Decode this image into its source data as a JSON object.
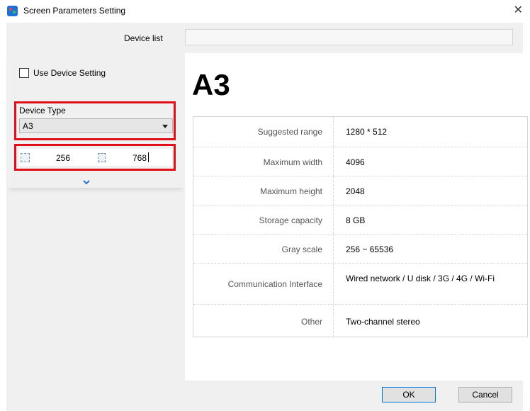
{
  "window": {
    "title": "Screen Parameters Setting",
    "close_icon": "close-icon"
  },
  "device_list": {
    "label": "Device list",
    "value": ""
  },
  "use_device_setting": {
    "label": "Use Device Setting",
    "checked": false
  },
  "device_type": {
    "label": "Device Type",
    "selected": "A3"
  },
  "size": {
    "width": "256",
    "height": "768"
  },
  "heading": "A3",
  "specs": [
    {
      "label": "Suggested range",
      "value": "1280 * 512"
    },
    {
      "label": "Maximum width",
      "value": "4096"
    },
    {
      "label": "Maximum height",
      "value": "2048"
    },
    {
      "label": "Storage capacity",
      "value": "8 GB"
    },
    {
      "label": "Gray scale",
      "value": "256 ~ 65536"
    },
    {
      "label": "Communication Interface",
      "value": "Wired network / U disk / 3G / 4G / Wi-Fi"
    },
    {
      "label": "Other",
      "value": "Two-channel stereo"
    }
  ],
  "buttons": {
    "ok": "OK",
    "cancel": "Cancel"
  },
  "colors": {
    "highlight_border": "#e0101a",
    "accent": "#0078d7",
    "chevron": "#2f6fd6"
  }
}
